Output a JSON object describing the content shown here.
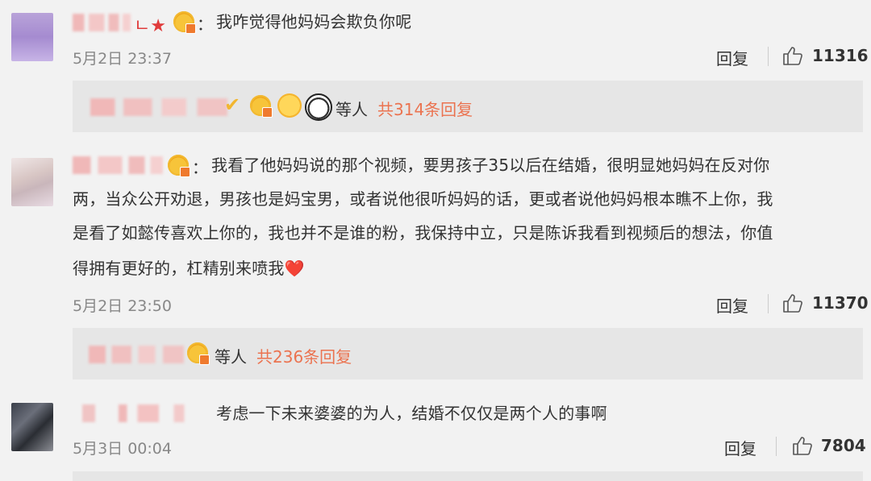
{
  "comments": [
    {
      "name_suffix": "ㄴ★",
      "text": "我咋觉得他妈妈会欺负你呢",
      "time": "5月2日 23:37",
      "reply_label": "回复",
      "likes": "11316",
      "replies": {
        "others": "等人",
        "count_label": "共314条回复"
      }
    },
    {
      "text_lines": [
        "我看了他妈妈说的那个视频，要男孩子35以后在结婚，很明显她妈妈在反对你",
        "两，当众公开劝退，男孩也是妈宝男，或者说他很听妈妈的话，更或者说他妈妈根本瞧不上你，我",
        "是看了如懿传喜欢上你的，我也并不是谁的粉，我保持中立，只是陈诉我看到视频后的想法，你值",
        "得拥有更好的，杠精别来喷我❤️"
      ],
      "time": "5月2日 23:50",
      "reply_label": "回复",
      "likes": "11370",
      "replies": {
        "others": "等人",
        "count_label": "共236条回复"
      }
    },
    {
      "text": "考虑一下未来婆婆的为人，结婚不仅仅是两个人的事啊",
      "time": "5月3日 00:04",
      "reply_label": "回复",
      "likes": "7804"
    }
  ],
  "colon": "：",
  "colors": {
    "accent": "#eb7350",
    "background": "#f2f2f2",
    "reply_bg": "#e6e6e6"
  }
}
